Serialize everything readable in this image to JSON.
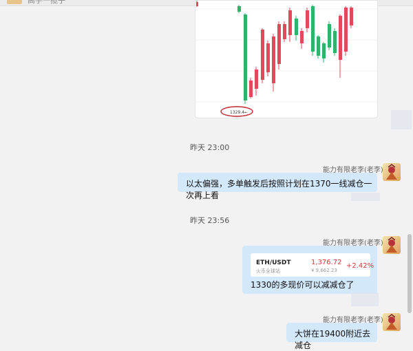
{
  "header": {
    "partial_text": "高手一揽子"
  },
  "chart_card": {
    "low_annotation": "1329.4"
  },
  "messages": [
    {
      "time": "昨天 23:00",
      "sender": "能力有限老李(老李)",
      "text": "以太偏强，多单触发后按照计划在1370一线减仓一次再上看"
    },
    {
      "time": "昨天 23:56",
      "sender": "能力有限老李(老李)",
      "quote": {
        "symbol": "ETH/USDT",
        "source": "火币全球站",
        "price": "1,376.72",
        "price_cny": "¥ 9,662.23",
        "change": "+2.42%"
      },
      "text": "1330的多现价可以减减仓了"
    },
    {
      "sender": "能力有限老李(老李)",
      "text": "大饼在19400附近去减仓"
    }
  ],
  "colors": {
    "bubble": "#d3e8fb",
    "candle_up": "#e04a5a",
    "candle_down": "#2fb36a",
    "annotation_circle": "#c0282f",
    "change_positive": "#d23a3a"
  },
  "icons": {
    "avatar": "monkey-king-avatar-icon"
  }
}
